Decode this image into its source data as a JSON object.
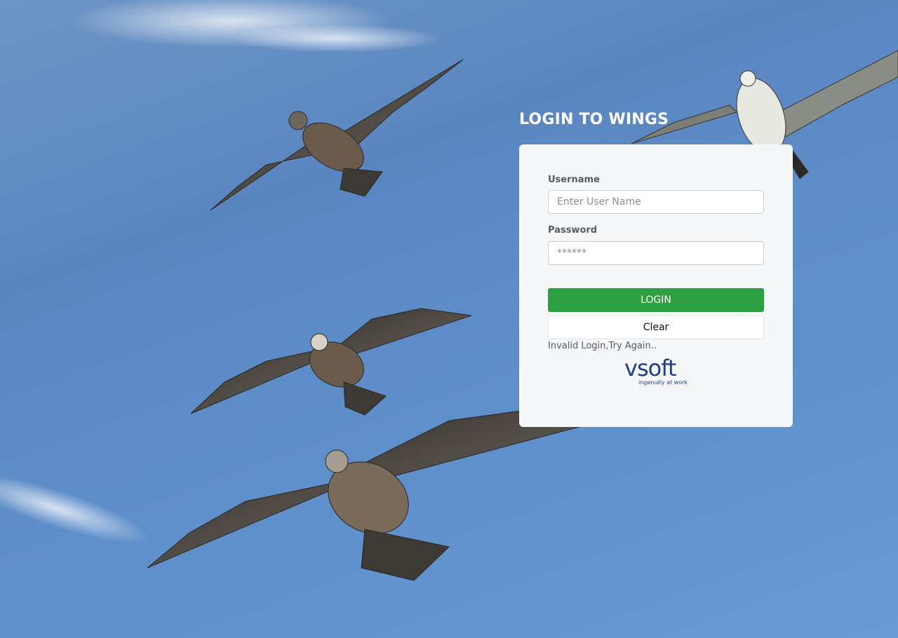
{
  "page": {
    "title": "LOGIN TO WINGS"
  },
  "form": {
    "username_label": "Username",
    "username_placeholder": "Enter User Name",
    "username_value": "",
    "password_label": "Password",
    "password_placeholder": "******",
    "password_value": "",
    "login_label": "LOGIN",
    "clear_label": "Clear",
    "error_message": "Invalid Login,Try Again.."
  },
  "logo": {
    "brand": "vsoft",
    "tagline": "ingenuity at work",
    "color": "#1f3f8a"
  },
  "colors": {
    "login_button": "#2ea043",
    "card_background": "#f6f7f9",
    "sky": "#5a86c0"
  },
  "background": {
    "icon": "seagulls-sky-photo"
  }
}
